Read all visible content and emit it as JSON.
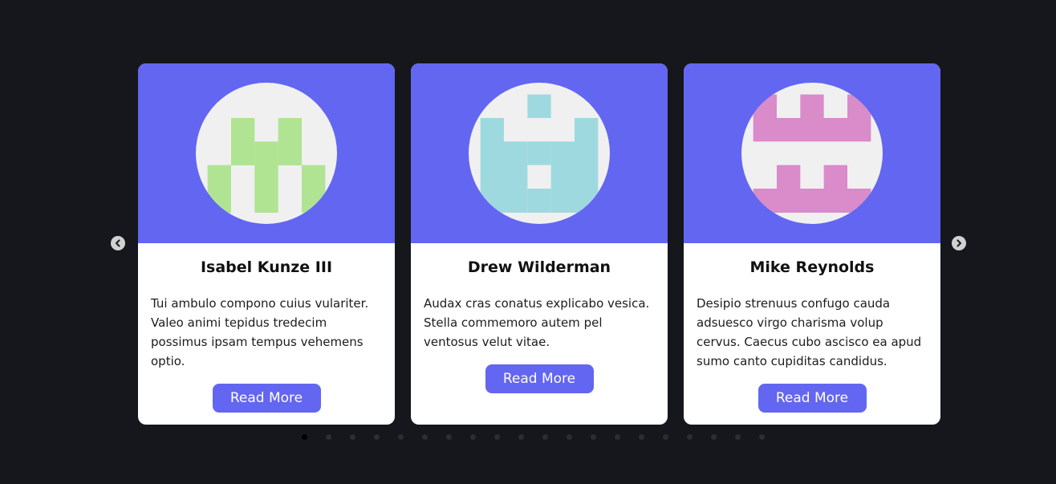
{
  "carousel": {
    "prev_icon": "chevron-left-icon",
    "next_icon": "chevron-right-icon",
    "cards": [
      {
        "name": "Isabel Kunze III",
        "description": "Tui ambulo compono cuius vulariter. Valeo animi tepidus tredecim possimus ipsam tempus vehemens optio.",
        "button_label": "Read More",
        "avatar_color": "#b0e492"
      },
      {
        "name": "Drew Wilderman",
        "description": "Audax cras conatus explicabo vesica. Stella commemoro autem pel ventosus velut vitae.",
        "button_label": "Read More",
        "avatar_color": "#9fd9e0"
      },
      {
        "name": "Mike Reynolds",
        "description": "Desipio strenuus confugo cauda adsuesco virgo charisma volup cervus. Caecus cubo ascisco ea apud sumo canto cupiditas candidus.",
        "button_label": "Read More",
        "avatar_color": "#d98bca"
      }
    ],
    "pagination": {
      "total_pages": 20,
      "active_page": 1
    }
  },
  "colors": {
    "background": "#15171c",
    "accent": "#6366f1",
    "card_background": "#ffffff",
    "avatar_background": "#f0f0f0"
  }
}
